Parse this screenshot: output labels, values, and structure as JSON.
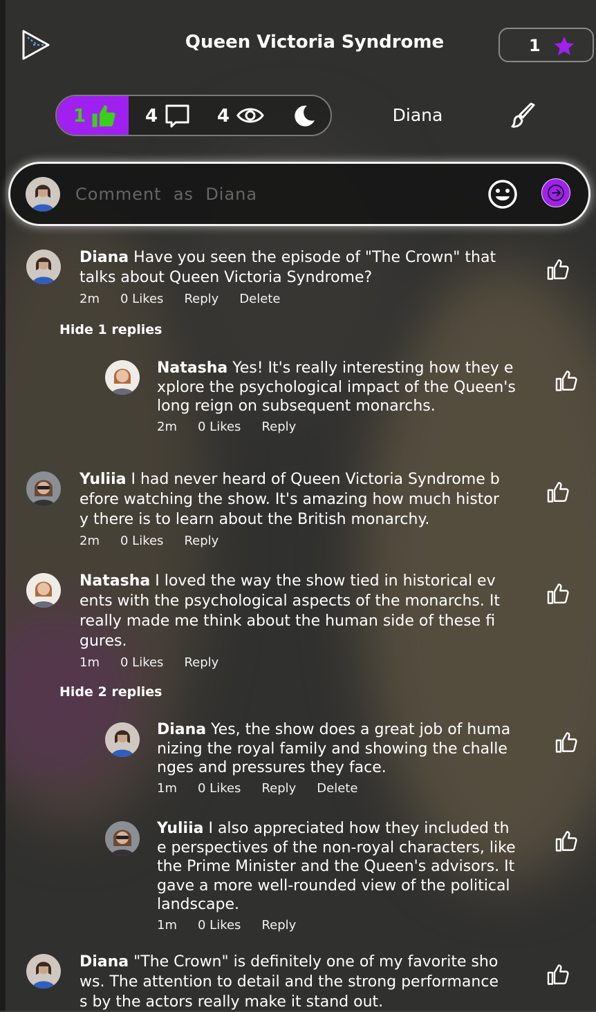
{
  "header": {
    "title": "Queen Victoria Syndrome",
    "star_count": "1"
  },
  "stats": {
    "likes": "1",
    "comments": "4",
    "views": "4"
  },
  "user": {
    "name": "Diana"
  },
  "composer": {
    "placeholder": "Comment  as  Diana"
  },
  "comments": [
    {
      "author": "Diana",
      "text": "Have you seen the episode of \"The Crown\" that talks about Queen Victoria Syndrome?",
      "time": "2m",
      "likes": "0 Likes",
      "reply": "Reply",
      "delete": "Delete"
    },
    {
      "author": "Natasha",
      "text": "Yes! It's really interesting how they explore the psychological impact of the Queen's long reign on subsequent monarchs.",
      "time": "2m",
      "likes": "0 Likes",
      "reply": "Reply"
    },
    {
      "author": "Yuliia",
      "text": "I had never heard of Queen Victoria Syndrome before watching the show. It's amazing how much history there is to learn about the British monarchy.",
      "time": "2m",
      "likes": "0 Likes",
      "reply": "Reply"
    },
    {
      "author": "Natasha",
      "text": "I loved the way the show tied in historical events with the psychological aspects of the monarchs. It really made me think about the human side of these figures.",
      "time": "1m",
      "likes": "0 Likes",
      "reply": "Reply"
    },
    {
      "author": "Diana",
      "text": "Yes, the show does a great job of humanizing the royal family and showing the challenges and pressures they face.",
      "time": "1m",
      "likes": "0 Likes",
      "reply": "Reply",
      "delete": "Delete"
    },
    {
      "author": "Yuliia",
      "text": "I also appreciated how they included the perspectives of the non-royal characters, like the Prime Minister and the Queen's advisors. It gave a more well-rounded view of the political landscape.",
      "time": "1m",
      "likes": "0 Likes",
      "reply": "Reply"
    },
    {
      "author": "Diana",
      "text": "\"The Crown\" is definitely one of my favorite shows. The attention to detail and the strong performances by the actors really make it stand out."
    }
  ],
  "toggles": {
    "hide_1": "Hide 1 replies",
    "hide_2": "Hide 2 replies"
  },
  "colors": {
    "accent": "#a020f0",
    "like_green": "#3ad01a"
  }
}
